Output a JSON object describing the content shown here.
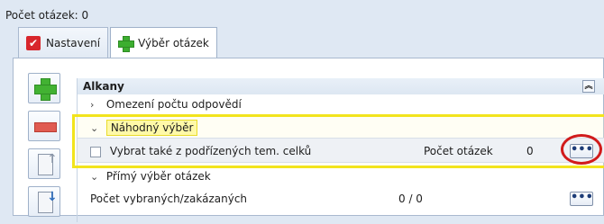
{
  "header": {
    "question_count_label": "Počet otázek: 0"
  },
  "tabs": [
    {
      "label": "Nastavení",
      "icon": "checkbox-red-icon"
    },
    {
      "label": "Výběr otázek",
      "icon": "plus-green-icon"
    }
  ],
  "toolbar": {
    "buttons": [
      "add-icon",
      "remove-icon",
      "move-up-icon",
      "move-down-icon"
    ]
  },
  "tree": {
    "group_title": "Alkany",
    "items": {
      "limit": "Omezení počtu odpovědí",
      "random": "Náhodný výběr",
      "include_sub_label": "Vybrat také z podřízených tem. celků",
      "count_label": "Počet otázek",
      "count_value": "0",
      "direct": "Přímý výběr otázek",
      "selected_label": "Počet vybraných/zakázaných",
      "selected_value": "0 / 0"
    }
  },
  "colors": {
    "highlight": "#f2e41c",
    "circle": "#d11b1b",
    "accent": "#42b232"
  }
}
